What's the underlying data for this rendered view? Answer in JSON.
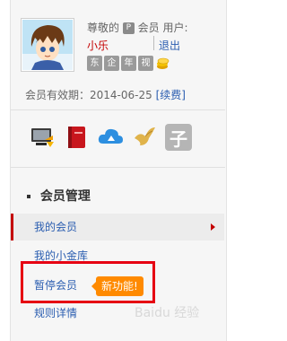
{
  "user": {
    "greeting_prefix": "尊敬的",
    "vip_badge": "P",
    "greeting_suffix": "会员 用户:",
    "username": "小乐",
    "logout_label": "退出",
    "privilege_icons": [
      "东",
      "企",
      "年",
      "视",
      "金币"
    ],
    "expiry_label": "会员有效期：2014-06-25",
    "renew_label": "[续费]"
  },
  "tools": [
    "desktop-app-icon",
    "red-book-icon",
    "cloud-icon",
    "bird-icon",
    "zi-icon"
  ],
  "tools_zi_char": "子",
  "section": {
    "title": "会员管理"
  },
  "menu": [
    {
      "label": "我的会员",
      "active": true
    },
    {
      "label": "我的小金库",
      "active": false
    },
    {
      "label": "暂停会员",
      "active": false
    },
    {
      "label": "规则详情",
      "active": false
    }
  ],
  "new_badge": "新功能!",
  "watermark": "Baidu 经验",
  "colors": {
    "accent_red": "#c40000",
    "link_blue": "#2a5db0",
    "badge_orange": "#ff8a00",
    "highlight_red": "#e60012"
  }
}
